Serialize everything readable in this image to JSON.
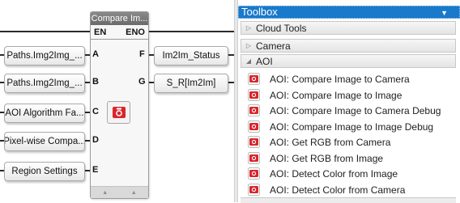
{
  "function_block": {
    "title": "Compare Im...",
    "en_label": "EN",
    "eno_label": "ENO",
    "icon": "camera-icon"
  },
  "inputs": [
    {
      "label": "Paths.Img2Img_...",
      "pin": "A"
    },
    {
      "label": "Paths.Img2Img_...",
      "pin": "B"
    },
    {
      "label": "AOI Algorithm Fa...",
      "pin": "C"
    },
    {
      "label": "Pixel-wise Compa...",
      "pin": "D"
    },
    {
      "label": "Region Settings",
      "pin": "E"
    }
  ],
  "outputs": [
    {
      "label": "Im2Im_Status",
      "pin": "F"
    },
    {
      "label": "S_R[Im2Im]",
      "pin": "G"
    }
  ],
  "toolbox": {
    "title": "Toolbox",
    "categories": [
      {
        "label": "Cloud Tools",
        "expanded": false
      },
      {
        "label": "Camera",
        "expanded": false
      },
      {
        "label": "AOI",
        "expanded": true
      }
    ],
    "items": [
      {
        "label": "AOI: Compare Image to Camera",
        "icon": "camera-icon"
      },
      {
        "label": "AOI: Compare Image to Image",
        "icon": "camera-icon"
      },
      {
        "label": "AOI: Compare Image to Camera Debug",
        "icon": "camera-icon"
      },
      {
        "label": "AOI: Compare Image to Image Debug",
        "icon": "camera-icon"
      },
      {
        "label": "AOI: Get RGB from Camera",
        "icon": "camera-icon"
      },
      {
        "label": "AOI: Get RGB from Image",
        "icon": "camera-icon"
      },
      {
        "label": "AOI: Detect Color from Image",
        "icon": "camera-icon"
      },
      {
        "label": "AOI: Detect Color from Camera",
        "icon": "camera-icon"
      }
    ]
  },
  "colors": {
    "accent": "#1979ca",
    "icon_red": "#d9262b"
  }
}
